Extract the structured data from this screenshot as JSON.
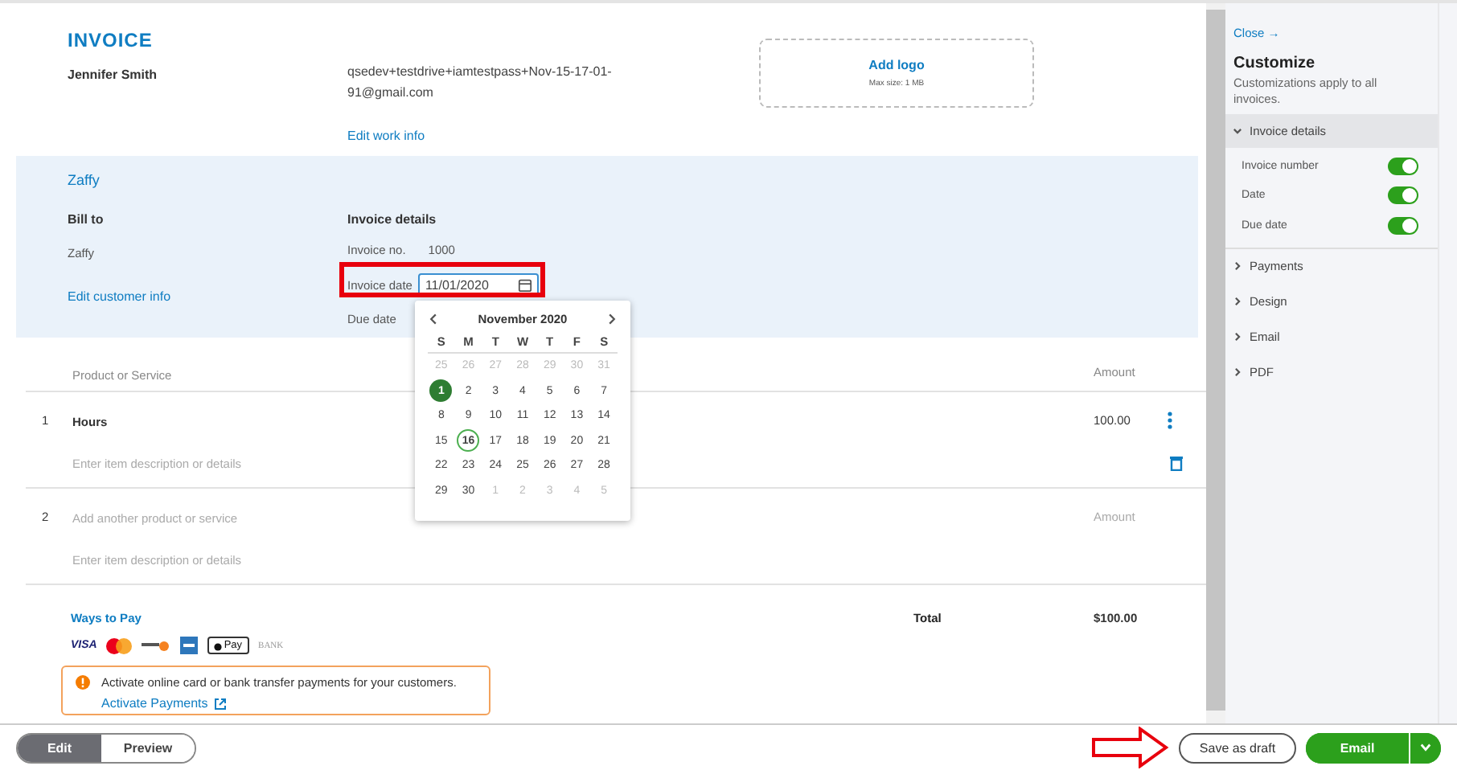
{
  "invoice": {
    "title": "INVOICE",
    "company": "Jennifer Smith",
    "email": "qsedev+testdrive+iamtestpass+Nov-15-17-01-91@gmail.com",
    "edit_work_info": "Edit work info",
    "logo": {
      "action": "Add logo",
      "hint": "Max size: 1 MB"
    }
  },
  "customer": {
    "name": "Zaffy",
    "bill_to_label": "Bill to",
    "bill_to": "Zaffy",
    "edit_customer": "Edit customer info",
    "details_label": "Invoice details",
    "invoice_no_label": "Invoice no.",
    "invoice_no": "1000",
    "invoice_date_label": "Invoice date",
    "invoice_date": "11/01/2020",
    "due_date_label": "Due date"
  },
  "calendar": {
    "month": "November 2020",
    "weekdays": [
      "S",
      "M",
      "T",
      "W",
      "T",
      "F",
      "S"
    ],
    "weeks": [
      [
        {
          "label": "25",
          "selected": false,
          "kind": "outside"
        },
        {
          "label": "26",
          "selected": false,
          "kind": "outside"
        },
        {
          "label": "27",
          "selected": false,
          "kind": "outside"
        },
        {
          "label": "28",
          "selected": false,
          "kind": "outside"
        },
        {
          "label": "29",
          "selected": false,
          "kind": "outside"
        },
        {
          "label": "30",
          "selected": false,
          "kind": "outside"
        },
        {
          "label": "31",
          "selected": false,
          "kind": "outside"
        }
      ],
      [
        {
          "label": "1",
          "selected": true,
          "kind": "day"
        },
        {
          "label": "2",
          "selected": false,
          "kind": "day"
        },
        {
          "label": "3",
          "selected": false,
          "kind": "day"
        },
        {
          "label": "4",
          "selected": false,
          "kind": "day"
        },
        {
          "label": "5",
          "selected": false,
          "kind": "day"
        },
        {
          "label": "6",
          "selected": false,
          "kind": "day"
        },
        {
          "label": "7",
          "selected": false,
          "kind": "day"
        }
      ],
      [
        {
          "label": "8",
          "selected": false,
          "kind": "day"
        },
        {
          "label": "9",
          "selected": false,
          "kind": "day"
        },
        {
          "label": "10",
          "selected": false,
          "kind": "day"
        },
        {
          "label": "11",
          "selected": false,
          "kind": "day"
        },
        {
          "label": "12",
          "selected": false,
          "kind": "day"
        },
        {
          "label": "13",
          "selected": false,
          "kind": "day"
        },
        {
          "label": "14",
          "selected": false,
          "kind": "day"
        }
      ],
      [
        {
          "label": "15",
          "selected": false,
          "kind": "day"
        },
        {
          "label": "16",
          "selected": false,
          "kind": "today"
        },
        {
          "label": "17",
          "selected": false,
          "kind": "day"
        },
        {
          "label": "18",
          "selected": false,
          "kind": "day"
        },
        {
          "label": "19",
          "selected": false,
          "kind": "day"
        },
        {
          "label": "20",
          "selected": false,
          "kind": "day"
        },
        {
          "label": "21",
          "selected": false,
          "kind": "day"
        }
      ],
      [
        {
          "label": "22",
          "selected": false,
          "kind": "day"
        },
        {
          "label": "23",
          "selected": false,
          "kind": "day"
        },
        {
          "label": "24",
          "selected": false,
          "kind": "day"
        },
        {
          "label": "25",
          "selected": false,
          "kind": "day"
        },
        {
          "label": "26",
          "selected": false,
          "kind": "day"
        },
        {
          "label": "27",
          "selected": false,
          "kind": "day"
        },
        {
          "label": "28",
          "selected": false,
          "kind": "day"
        }
      ],
      [
        {
          "label": "29",
          "selected": false,
          "kind": "day"
        },
        {
          "label": "30",
          "selected": false,
          "kind": "day"
        },
        {
          "label": "1",
          "selected": false,
          "kind": "outside"
        },
        {
          "label": "2",
          "selected": false,
          "kind": "outside"
        },
        {
          "label": "3",
          "selected": false,
          "kind": "outside"
        },
        {
          "label": "4",
          "selected": false,
          "kind": "outside"
        },
        {
          "label": "5",
          "selected": false,
          "kind": "outside"
        }
      ]
    ]
  },
  "table": {
    "columns": [
      "Product or Service",
      "Amount"
    ],
    "rows": [
      {
        "number": "1",
        "product": "Hours",
        "product_placeholder": "",
        "amount": "100.00",
        "amount_placeholder": "",
        "description_placeholder": "Enter item description or details"
      },
      {
        "number": "2",
        "product": "",
        "product_placeholder": "Add another product or service",
        "amount": "",
        "amount_placeholder": "Amount",
        "description_placeholder": "Enter item description or details"
      }
    ]
  },
  "payment": {
    "title": "Ways to Pay",
    "methods": [
      {
        "kind": "visa",
        "label": "VISA"
      },
      {
        "kind": "mastercard"
      },
      {
        "kind": "discover"
      },
      {
        "kind": "amex"
      },
      {
        "kind": "applepay",
        "label": "Pay"
      },
      {
        "kind": "bank",
        "label": "BANK"
      }
    ],
    "alert": "Activate online card or bank transfer payments for your customers.",
    "alert_link": "Activate Payments"
  },
  "total": {
    "label": "Total",
    "value": "$100.00"
  },
  "customize": {
    "close": "Close →",
    "title": "Customize",
    "subtitle": "Customizations apply to all invoices.",
    "sections": [
      {
        "label": "Invoice details",
        "expanded": true,
        "toggles": [
          {
            "label": "Invoice number",
            "on": true
          },
          {
            "label": "Date",
            "on": true
          },
          {
            "label": "Due date",
            "on": true
          }
        ]
      },
      {
        "label": "Payments",
        "expanded": false
      },
      {
        "label": "Design",
        "expanded": false
      },
      {
        "label": "Email",
        "expanded": false
      },
      {
        "label": "PDF",
        "expanded": false
      }
    ]
  },
  "footer": {
    "modes": [
      {
        "label": "Edit",
        "selected": true
      },
      {
        "label": "Preview",
        "selected": false
      }
    ],
    "save_draft": "Save as draft",
    "email": "Email"
  }
}
